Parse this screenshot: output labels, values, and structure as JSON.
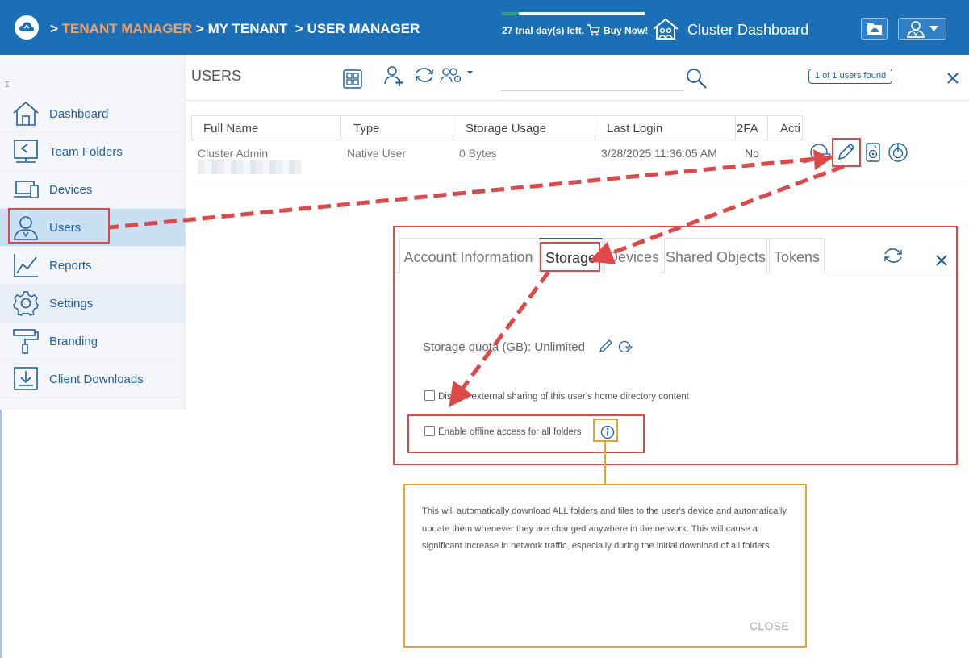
{
  "header": {
    "breadcrumb_separator": ">",
    "breadcrumb": [
      "TENANT MANAGER",
      "MY TENANT",
      "USER MANAGER"
    ],
    "trial_text": "27 trial day(s) left.",
    "buy_link": "Buy Now!",
    "cluster_label": "Cluster Dashboard"
  },
  "sidebar": {
    "items": [
      {
        "label": "Dashboard",
        "icon": "home-icon"
      },
      {
        "label": "Team Folders",
        "icon": "team-folders-icon"
      },
      {
        "label": "Devices",
        "icon": "devices-icon"
      },
      {
        "label": "Users",
        "icon": "users-icon",
        "active": true
      },
      {
        "label": "Reports",
        "icon": "reports-icon"
      },
      {
        "label": "Settings",
        "icon": "settings-icon"
      },
      {
        "label": "Branding",
        "icon": "branding-icon"
      },
      {
        "label": "Client Downloads",
        "icon": "client-downloads-icon"
      }
    ]
  },
  "users": {
    "title": "USERS",
    "found_badge": "1 of 1 users found",
    "columns": [
      "Full Name",
      "Type",
      "Storage Usage",
      "Last Login",
      "2FA",
      "Acti"
    ],
    "rows": [
      {
        "full_name": "Cluster Admin",
        "type": "Native User",
        "storage": "0 Bytes",
        "last_login": "3/28/2025 11:36:05 AM",
        "twofa": "No"
      }
    ]
  },
  "storage_panel": {
    "tabs": [
      "Account Information",
      "Storage",
      "Devices",
      "Shared Objects",
      "Tokens"
    ],
    "active_tab": "Storage",
    "quota_label": "Storage quota (GB):",
    "quota_value": "Unlimited",
    "disable_sharing_label": "Disable external sharing of this user's home directory content",
    "offline_access_label": "Enable offline access for all folders"
  },
  "tooltip": {
    "text": "This will automatically download ALL folders and files to the user's device and automatically update them whenever they are changed anywhere in the network. This will cause a significant increase in network traffic, especially during the initial download of all folders.",
    "close_label": "CLOSE"
  },
  "colors": {
    "header_bg": "#1b6fb7",
    "accent_text": "#f0a060",
    "link_blue": "#1f5f9e",
    "annotation_red": "#e04848",
    "annotation_orange": "#e8a52c",
    "trial_green": "#2ca66a"
  },
  "trial_progress": 0.12
}
